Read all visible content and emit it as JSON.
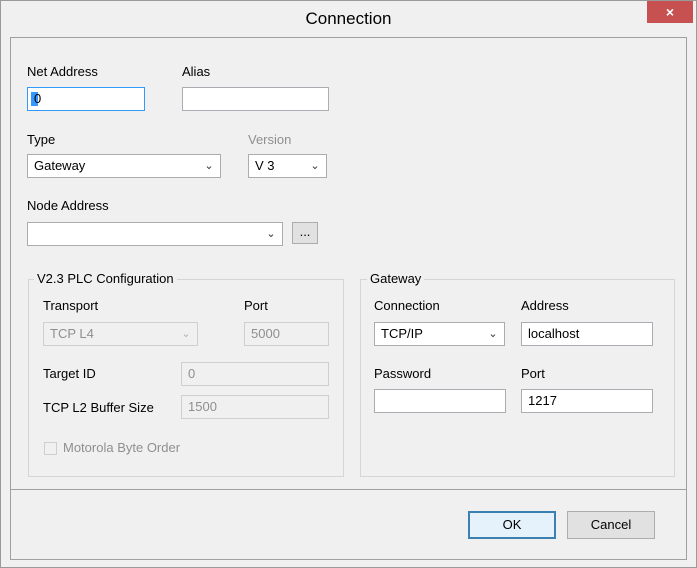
{
  "window": {
    "title": "Connection",
    "close": "×"
  },
  "fields": {
    "net_address": {
      "label": "Net Address",
      "value": "0"
    },
    "alias": {
      "label": "Alias",
      "value": ""
    },
    "type": {
      "label": "Type",
      "value": "Gateway"
    },
    "version": {
      "label": "Version",
      "value": "V 3"
    },
    "node_address": {
      "label": "Node Address",
      "value": "",
      "browse": "..."
    }
  },
  "plc_config": {
    "title": "V2.3 PLC Configuration",
    "transport": {
      "label": "Transport",
      "value": "TCP L4"
    },
    "port": {
      "label": "Port",
      "value": "5000"
    },
    "target_id": {
      "label": "Target ID",
      "value": "0"
    },
    "buffer_size": {
      "label": "TCP L2 Buffer Size",
      "value": "1500"
    },
    "motorola": {
      "label": "Motorola Byte Order",
      "checked": false
    }
  },
  "gateway": {
    "title": "Gateway",
    "connection": {
      "label": "Connection",
      "value": "TCP/IP"
    },
    "address": {
      "label": "Address",
      "value": "localhost"
    },
    "password": {
      "label": "Password",
      "value": ""
    },
    "port": {
      "label": "Port",
      "value": "1217"
    }
  },
  "buttons": {
    "ok": "OK",
    "cancel": "Cancel"
  },
  "icons": {
    "dropdown": "chevron-down-icon",
    "close": "close-icon"
  }
}
